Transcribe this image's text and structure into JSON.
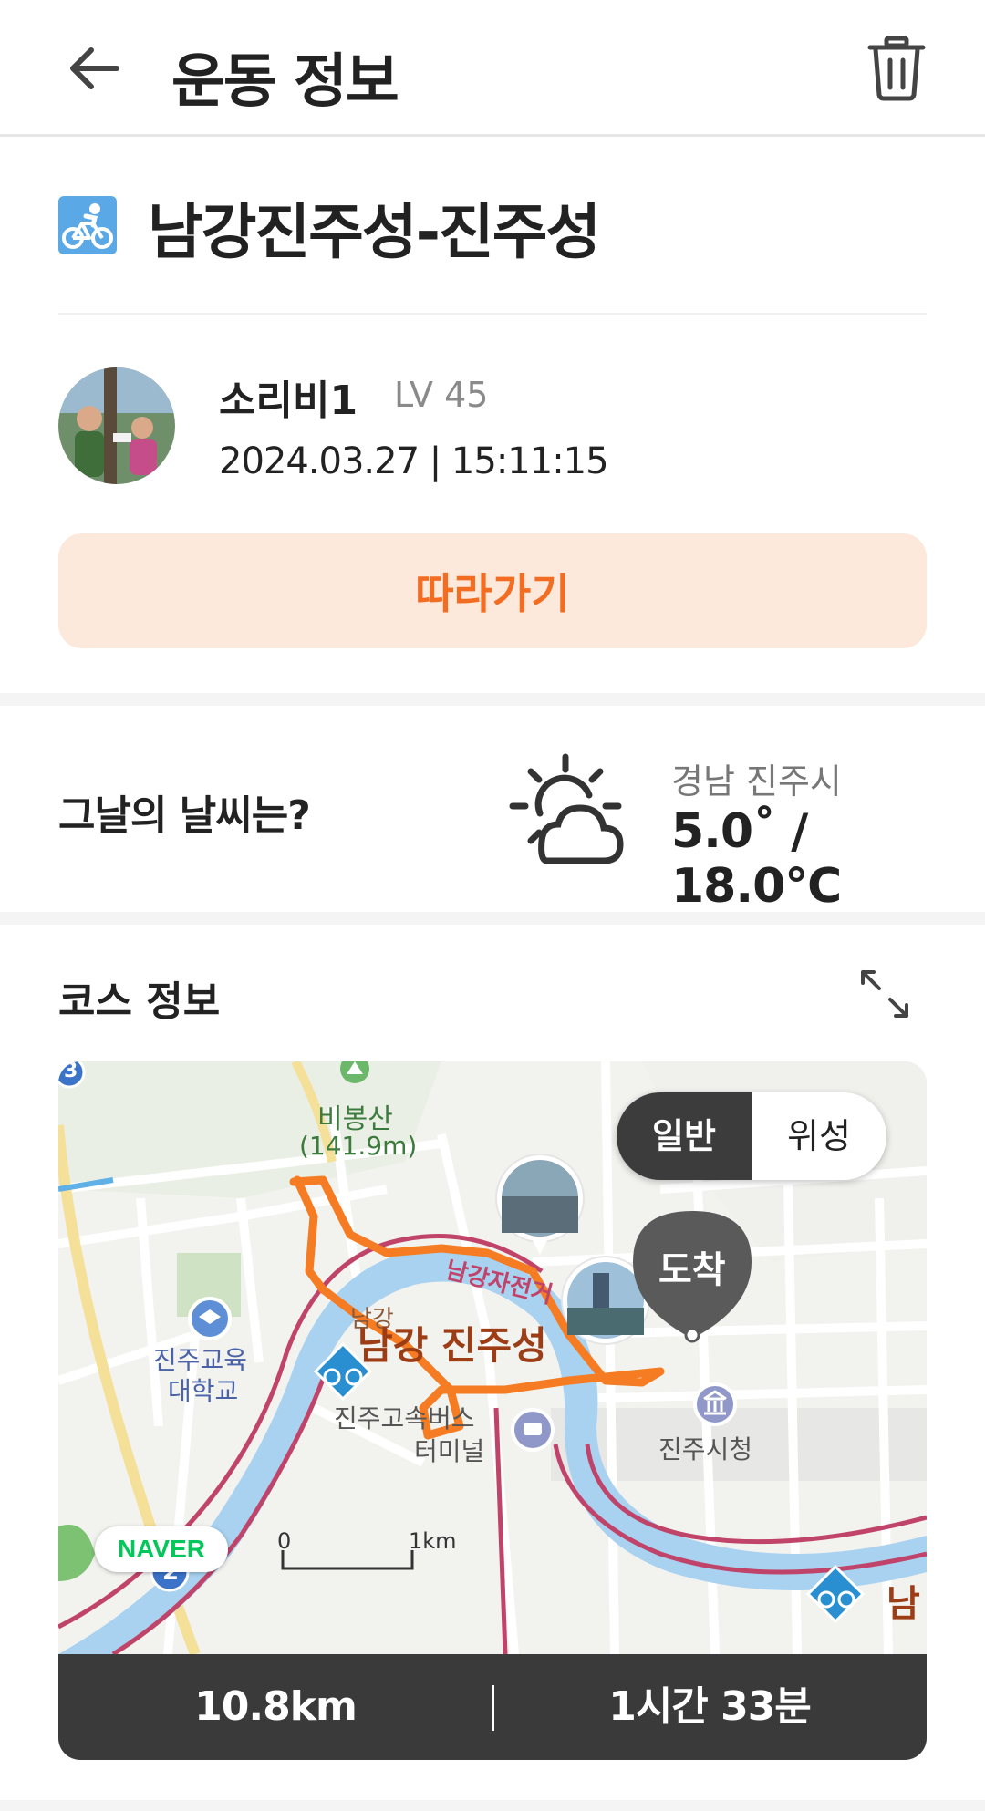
{
  "header": {
    "title": "운동 정보",
    "back_icon": "arrow-left-icon",
    "trash_icon": "trash-icon"
  },
  "activity": {
    "type_icon": "bicycle-icon",
    "title": "남강진주성-진주성"
  },
  "user": {
    "name": "소리비1",
    "level": "LV 45",
    "datetime": "2024.03.27 | 15:11:15"
  },
  "follow_button": {
    "label": "따라가기"
  },
  "weather": {
    "question": "그날의 날씨는?",
    "icon": "partly-cloudy-icon",
    "location": "경남 진주시",
    "temperature": "5.0˚ / 18.0℃"
  },
  "course": {
    "label": "코스 정보",
    "expand_icon": "expand-icon"
  },
  "map": {
    "mode_toggle": {
      "general": "일반",
      "satellite": "위성",
      "selected": "일반"
    },
    "labels": {
      "mountain": "비봉산",
      "mountain_height": "(141.9m)",
      "route_name": "남강자전거",
      "fortress": "남강 진주성",
      "namgang_small": "남강",
      "university_1": "진주교육",
      "university_2": "대학교",
      "terminal_1": "진주고속버스",
      "terminal_2": "터미널",
      "city_hall": "진주시청",
      "arrival": "도착",
      "edge_label": "남",
      "route_badge_3": "3",
      "route_badge_2": "2"
    },
    "scale": {
      "start": "0",
      "end": "1km"
    },
    "brand": "NAVER",
    "colors": {
      "route": "#f57c22",
      "river": "#a9d2f0",
      "bike_path": "#c0446a"
    }
  },
  "stats": {
    "distance": "10.8km",
    "duration": "1시간 33분"
  }
}
